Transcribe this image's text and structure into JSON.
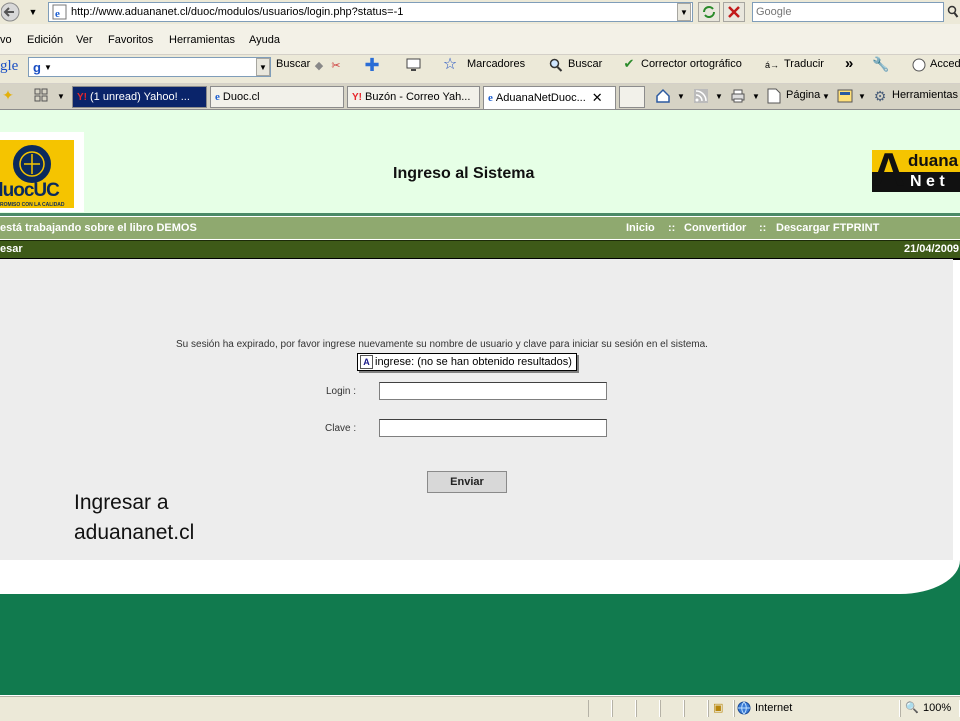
{
  "browser": {
    "url": "http://www.aduananet.cl/duoc/modulos/usuarios/login.php?status=-1",
    "search_placeholder": "Google",
    "menu": [
      "vo",
      "Edición",
      "Ver",
      "Favoritos",
      "Herramientas",
      "Ayuda"
    ],
    "google_bar": {
      "logo_text": "gle",
      "search_button": "Buscar",
      "bookmarks": "Marcadores",
      "find": "Buscar",
      "spellcheck": "Corrector ortográfico",
      "translate": "Traducir",
      "more": "»",
      "access": "Acced"
    },
    "tabs": [
      {
        "label": "(1 unread) Yahoo! ...",
        "icon": "yahoo-mail-icon",
        "state": "dark"
      },
      {
        "label": "Duoc.cl",
        "icon": "ie-page-icon",
        "state": "normal"
      },
      {
        "label": "Buzón - Correo Yah...",
        "icon": "yahoo-mail-icon",
        "state": "normal"
      },
      {
        "label": "AduanaNetDuoc...",
        "icon": "ie-page-icon",
        "state": "active"
      }
    ],
    "command_bar": {
      "page": "Página",
      "tools": "Herramientas"
    },
    "status": {
      "zone": "Internet",
      "zoom": "100%"
    }
  },
  "header": {
    "left_logo_text": "duocUC",
    "left_logo_sub": "ROMISO CON LA CALIDAD",
    "title": "Ingreso al Sistema",
    "right_logo_word1": "duana",
    "right_logo_word2": "N e t",
    "right_logo_A": "A"
  },
  "status_strip": {
    "left": "está trabajando sobre el libro DEMOS",
    "links": [
      "Inicio",
      "::",
      "Convertidor",
      "::",
      "Descargar FTPRINT"
    ]
  },
  "dark_strip": {
    "left": "esar",
    "date": "21/04/2009"
  },
  "login": {
    "message": "Su sesión ha expirado, por favor ingrese nuevamente su nombre de usuario y clave para iniciar su sesión en el sistema.",
    "tooltip": "ingrese: (no se han obtenido resultados)",
    "login_label": "Login :",
    "login_value": "",
    "password_label": "Clave :",
    "password_value": "",
    "submit": "Enviar"
  },
  "caption": "Ingresar a aduananet.cl",
  "colors": {
    "header_bg": "#e6ffe6",
    "strip_green": "#8fa96f",
    "strip_dark": "#3e5a18",
    "footer_green": "#117a4e",
    "duoc_yellow": "#f5c400"
  }
}
